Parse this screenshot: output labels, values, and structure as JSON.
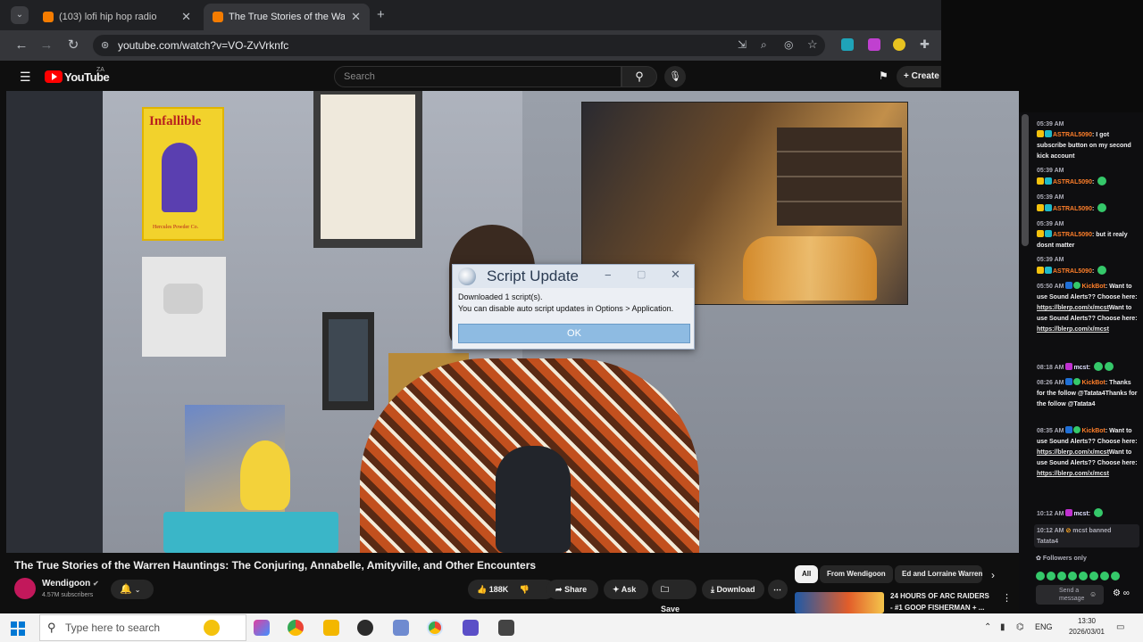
{
  "browser": {
    "tabs": [
      {
        "title": "(103) lofi hip hop radio",
        "active": false
      },
      {
        "title": "The True Stories of the Warr",
        "active": true
      }
    ],
    "new_tab": "+",
    "url": "youtube.com/watch?v=VO-ZvVrknfc"
  },
  "youtube": {
    "logo_text": "YouTube",
    "country": "ZA",
    "search_placeholder": "Search",
    "create_label": "Create"
  },
  "dialog": {
    "title": "Script Update",
    "line1": "Downloaded 1 script(s).",
    "line2": "You can disable auto script updates in Options > Application.",
    "ok_label": "OK"
  },
  "video": {
    "title": "The True Stories of the Warren Hauntings: The Conjuring, Annabelle, Amityville, and Other Encounters",
    "channel": "Wendigoon",
    "subscribers": "4.57M subscribers",
    "likes": "188K",
    "share": "Share",
    "ask": "Ask",
    "save": "Save",
    "download": "Download",
    "poster_text": "Infallible",
    "poster_sub": "Hercules Powder Co."
  },
  "chips": {
    "all": "All",
    "from": "From Wendigoon",
    "ed": "Ed and Lorraine Warren"
  },
  "recommendation": {
    "line1": "24 HOURS OF ARC RAIDERS",
    "line2": "- #1 GOOP FISHERMAN + ..."
  },
  "chat": {
    "messages": [
      {
        "time": "05:39 AM",
        "user": "ASTRAL5090",
        "text": "I got subscribe button on my second kick account"
      },
      {
        "time": "05:39 AM",
        "user": "ASTRAL5090",
        "text": ""
      },
      {
        "time": "05:39 AM",
        "user": "ASTRAL5090",
        "text": ""
      },
      {
        "time": "05:39 AM",
        "user": "ASTRAL5090",
        "text": "but it realy dosnt matter"
      },
      {
        "time": "05:39 AM",
        "user": "ASTRAL5090",
        "text": ""
      },
      {
        "time": "05:50 AM",
        "user": "KickBot",
        "text": "Want to use Sound Alerts?? Choose here:",
        "link": "https://blerp.com/x/mcst",
        "text2": "Want to use Sound Alerts?? Choose here:",
        "link2": "https://blerp.com/x/mcst"
      },
      {
        "time": "08:18 AM",
        "user": "mcst",
        "text": ""
      },
      {
        "time": "08:26 AM",
        "user": "KickBot",
        "text": "Thanks for the follow @Tatata4Thanks for the follow @Tatata4"
      },
      {
        "time": "08:35 AM",
        "user": "KickBot",
        "text": "Want to use Sound Alerts?? Choose here:",
        "link": "https://blerp.com/x/mcst",
        "text2": "Want to use Sound Alerts?? Choose here:",
        "link2": "https://blerp.com/x/mcst"
      },
      {
        "time": "10:12 AM",
        "user": "mcst",
        "text": ""
      }
    ],
    "ban_time": "10:12 AM",
    "ban_text": "mcst banned",
    "ban_target": "Tatata4",
    "followers_only": "Followers only",
    "input_placeholder": "Send a message"
  },
  "taskbar": {
    "search_placeholder": "Type here to search",
    "lang": "ENG",
    "time": "13:30",
    "date": "2026/03/01"
  },
  "colors": {
    "accent_youtube": "#ff0000",
    "kick_green": "#53fc18",
    "dialog_ok": "#8ebbe2"
  }
}
